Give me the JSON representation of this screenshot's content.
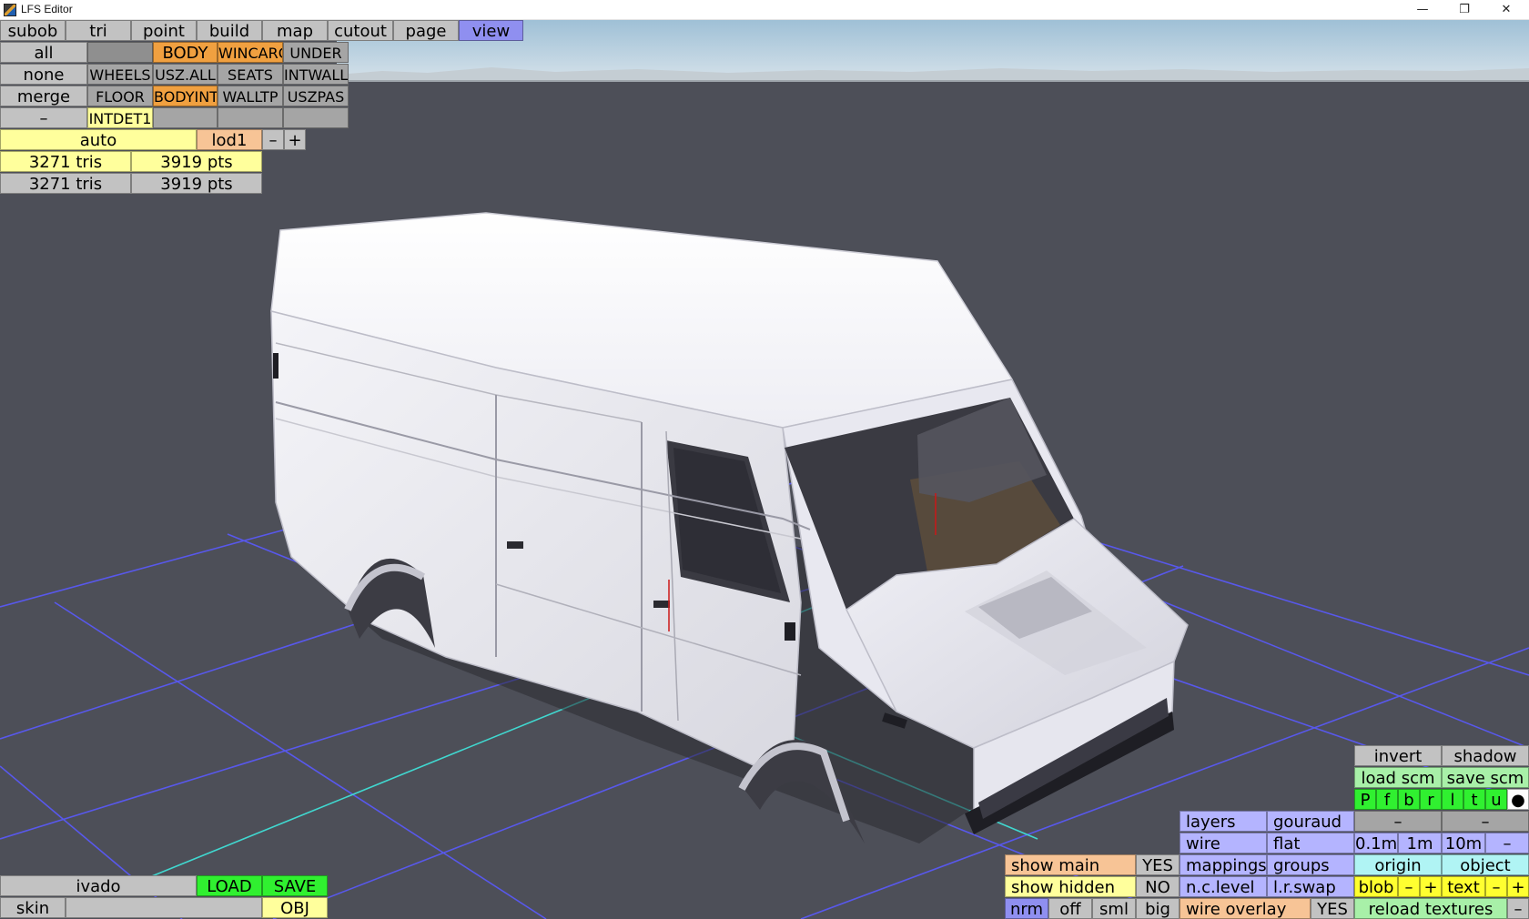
{
  "window": {
    "title": "LFS Editor",
    "minimize_glyph": "—",
    "maximize_glyph": "❐",
    "close_glyph": "✕"
  },
  "tabs": [
    "subob",
    "tri",
    "point",
    "build",
    "map",
    "cutout",
    "page",
    "view"
  ],
  "active_tab": "view",
  "groups": {
    "all": "all",
    "none": "none",
    "merge": "merge",
    "dash": "–",
    "body": "BODY",
    "wincarg": "WINCARG",
    "under": "UNDER",
    "wheels": "WHEELS",
    "usz_all": "USZ.ALL",
    "seats": "SEATS",
    "intwall": "INTWALL",
    "floor": "FLOOR",
    "bodyint": "BODYINT",
    "walltp": "WALLTP",
    "uszpas": "USZPAS",
    "intdet1": "INTDET1"
  },
  "lod": {
    "mode": "auto",
    "level": "lod1",
    "minus": "–",
    "plus": "+"
  },
  "stats": [
    {
      "tris": "3271 tris",
      "pts": "3919 pts"
    },
    {
      "tris": "3271 tris",
      "pts": "3919 pts"
    }
  ],
  "file": {
    "name": "ivado",
    "load": "LOAD",
    "save": "SAVE",
    "skin": "skin",
    "obj": "OBJ"
  },
  "display": {
    "show_main": "show main",
    "show_main_value": "YES",
    "show_hidden": "show hidden",
    "show_hidden_value": "NO",
    "size_nrm": "nrm",
    "size_off": "off",
    "size_sml": "sml",
    "size_big": "big",
    "wire_overlay": "wire overlay",
    "wire_overlay_value": "YES"
  },
  "render": {
    "layers": "layers",
    "gouraud": "gouraud",
    "wire": "wire",
    "flat": "flat",
    "mappings": "mappings",
    "groups": "groups",
    "nc_level": "n.c.level",
    "lr_swap": "l.r.swap"
  },
  "view_panel": {
    "invert": "invert",
    "shadow": "shadow",
    "load_scm": "load scm",
    "save_scm": "save scm",
    "views": [
      "P",
      "f",
      "b",
      "r",
      "l",
      "t",
      "u",
      "●"
    ],
    "dash_left": "–",
    "dash_right": "–",
    "grid_01": "0.1m",
    "grid_1": "1m",
    "grid_10": "10m",
    "grid_dash": "–",
    "origin": "origin",
    "object": "object",
    "blob": "blob",
    "blob_minus": "–",
    "blob_plus": "+",
    "text": "text",
    "text_minus": "–",
    "text_plus": "+",
    "reload_textures": "reload textures",
    "reload_dash": "–"
  }
}
